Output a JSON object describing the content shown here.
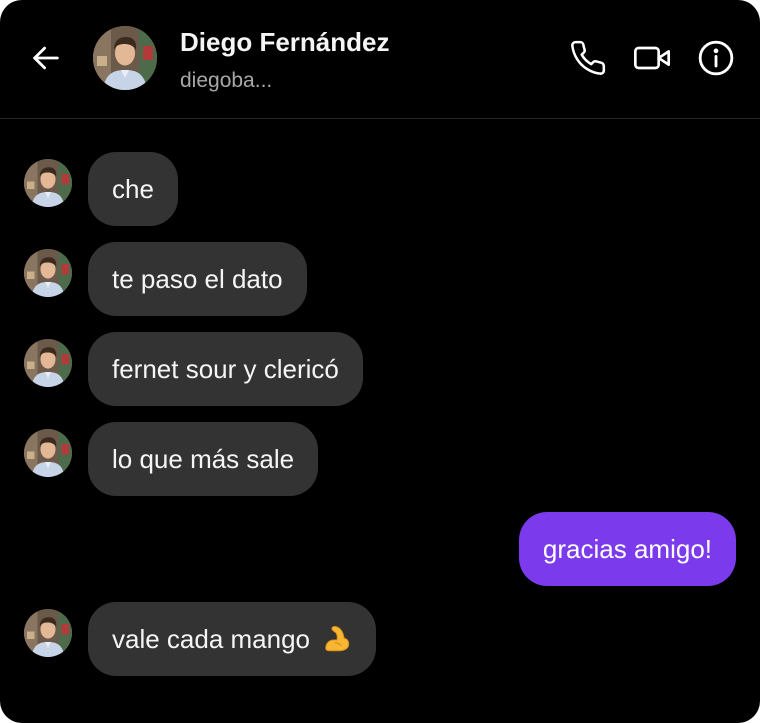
{
  "header": {
    "contact_name": "Diego Fernández",
    "username": "diegoba...",
    "icons": [
      "back-arrow-icon",
      "phone-icon",
      "video-camera-icon",
      "info-icon"
    ]
  },
  "messages": [
    {
      "from": "contact",
      "text": "che"
    },
    {
      "from": "contact",
      "text": "te paso el dato"
    },
    {
      "from": "contact",
      "text": "fernet sour y clericó"
    },
    {
      "from": "contact",
      "text": "lo que más sale"
    },
    {
      "from": "me",
      "text": "gracias amigo!"
    },
    {
      "from": "contact",
      "text": "vale cada mango",
      "emoji": "flexed-biceps"
    }
  ],
  "colors": {
    "background": "#000000",
    "incoming_bubble": "#333333",
    "outgoing_bubble": "#7b3aec",
    "secondary_text": "#a8a8a8"
  }
}
